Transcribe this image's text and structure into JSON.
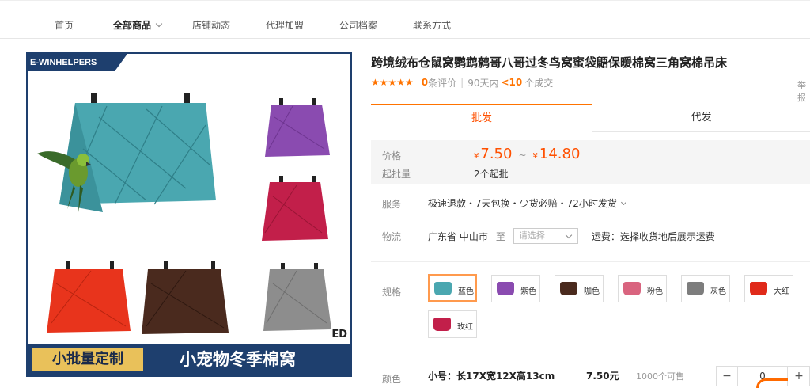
{
  "nav": {
    "items": [
      {
        "label": "首页"
      },
      {
        "label": "全部商品"
      },
      {
        "label": "店铺动态"
      },
      {
        "label": "代理加盟"
      },
      {
        "label": "公司档案"
      },
      {
        "label": "联系方式"
      }
    ]
  },
  "image": {
    "brand": "E-WINHELPERS",
    "banner_left": "小批量定制",
    "banner_right": "小宠物冬季棉窝",
    "corner_mark": "ED",
    "colors": {
      "teal": "#4aa7b0",
      "purple": "#8a4bb0",
      "rose": "#c21f4a",
      "red": "#e8341c",
      "brown": "#4a2a1e",
      "gray": "#8d8d8d",
      "frame": "#1e3f6e",
      "banner_gold": "#e9c15a"
    }
  },
  "product": {
    "title": "跨境绒布仓鼠窝鹦鹉鹩哥八哥过冬鸟窝蜜袋鼯保暖棉窝三角窝棉吊床",
    "reviews_count": "0",
    "reviews_label": "条评价",
    "deals_prefix": "90天内",
    "deals_count": "<10",
    "deals_suffix": "个成交",
    "right_cut_text": "举报"
  },
  "tabs": {
    "wholesale": "批发",
    "dropship": "代发"
  },
  "price": {
    "label": "价格",
    "currency": "¥",
    "low": "7.50",
    "tilde": "~",
    "high": "14.80",
    "min_label": "起批量",
    "min_value": "2个起批"
  },
  "service": {
    "label": "服务",
    "text": "极速退款・7天包换・少货必赔・72小时发货"
  },
  "logistics": {
    "label": "物流",
    "origin": "广东省 中山市",
    "to": "至",
    "select_placeholder": "请选择",
    "fee_text": "运费：选择收货地后展示运费"
  },
  "specs": {
    "label": "规格",
    "options": [
      {
        "label": "蓝色",
        "color": "#4aa7b0"
      },
      {
        "label": "紫色",
        "color": "#8a4bb0"
      },
      {
        "label": "咖色",
        "color": "#4a2a1e"
      },
      {
        "label": "粉色",
        "color": "#d9647f"
      },
      {
        "label": "灰色",
        "color": "#7d7d7d"
      },
      {
        "label": "大红",
        "color": "#e02a1a"
      },
      {
        "label": "玫红",
        "color": "#c21f4a"
      }
    ]
  },
  "color_row": {
    "label": "颜色",
    "size_text": "小号：长17X宽12X高13cm",
    "unit_price": "7.50元",
    "available": "1000个可售",
    "minus": "−",
    "quantity": "0",
    "plus": "+"
  }
}
